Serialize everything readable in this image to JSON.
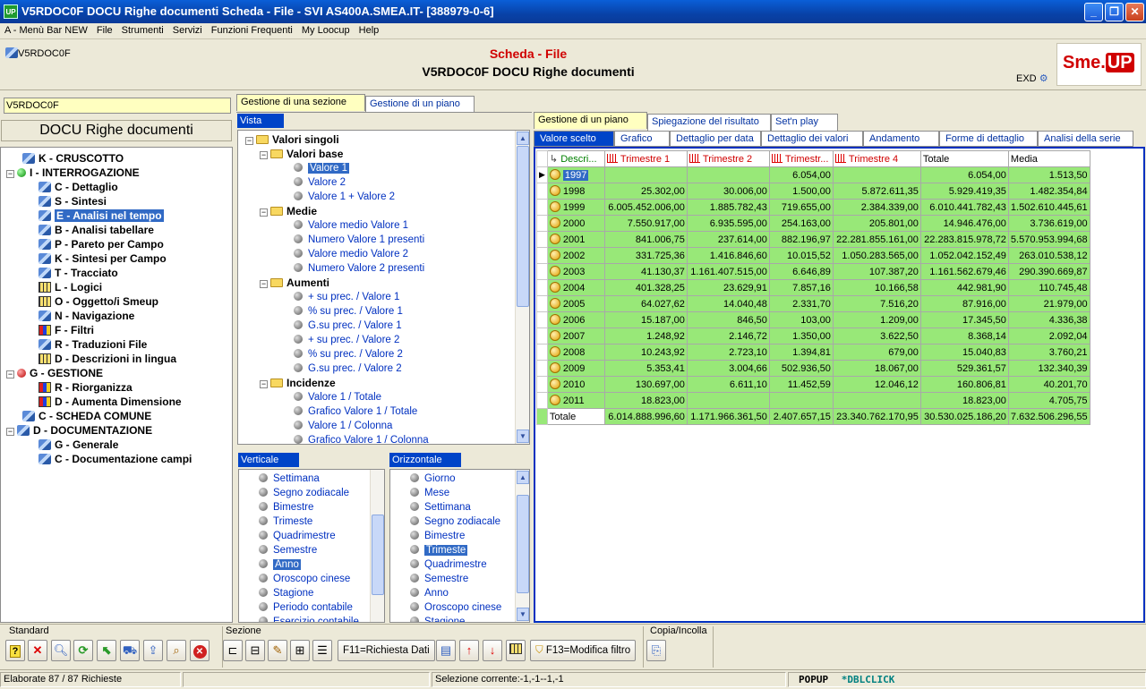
{
  "window": {
    "title": "V5RDOC0F DOCU Righe documenti Scheda - File - SVI AS400A.SMEA.IT- [388979-0-6]",
    "app_icon": "UP"
  },
  "menu": [
    "A - Menù Bar NEW",
    "File",
    "Strumenti",
    "Servizi",
    "Funzioni Frequenti",
    "My Loocup",
    "Help"
  ],
  "header": {
    "object_code": "V5RDOC0F",
    "title_red": "Scheda - File",
    "title_main": "V5RDOC0F DOCU Righe documenti",
    "exd_label": "EXD",
    "logo_text_1": "Sme.",
    "logo_text_2": "UP"
  },
  "left": {
    "input_value": "V5RDOC0F",
    "doc_title": "DOCU Righe documenti",
    "tree": [
      {
        "label": "K - CRUSCOTTO",
        "icon": "gear-icon",
        "level": 1
      },
      {
        "label": "I - INTERROGAZIONE",
        "icon": "green-dot-icon",
        "level": 0,
        "expander": "−"
      },
      {
        "label": "C - Dettaglio",
        "icon": "gear-icon",
        "level": 2
      },
      {
        "label": "S - Sintesi",
        "icon": "gear-icon",
        "level": 2
      },
      {
        "label": "E - Analisi nel tempo",
        "icon": "gear-icon",
        "level": 2,
        "selected": true
      },
      {
        "label": "B - Analisi tabellare",
        "icon": "gear-icon",
        "level": 2
      },
      {
        "label": "P - Pareto per Campo",
        "icon": "gear-icon",
        "level": 2
      },
      {
        "label": "K - Sintesi per Campo",
        "icon": "gear-icon",
        "level": 2
      },
      {
        "label": "T - Tracciato",
        "icon": "gear-icon",
        "level": 2
      },
      {
        "label": "L - Logici",
        "icon": "columns-icon",
        "level": 2
      },
      {
        "label": "O - Oggetto/i Smeup",
        "icon": "columns-icon",
        "level": 2
      },
      {
        "label": "N - Navigazione",
        "icon": "gear-icon",
        "level": 2
      },
      {
        "label": "F - Filtri",
        "icon": "color-grid-icon",
        "level": 2
      },
      {
        "label": "R - Traduzioni File",
        "icon": "gear-icon",
        "level": 2
      },
      {
        "label": "D - Descrizioni in lingua",
        "icon": "columns-icon",
        "level": 2
      },
      {
        "label": "G - GESTIONE",
        "icon": "red-dot-icon",
        "level": 0,
        "expander": "−"
      },
      {
        "label": "R - Riorganizza",
        "icon": "color-grid-icon",
        "level": 2
      },
      {
        "label": "D - Aumenta Dimensione",
        "icon": "color-grid-icon",
        "level": 2
      },
      {
        "label": "C - SCHEDA COMUNE",
        "icon": "gear-icon",
        "level": 1
      },
      {
        "label": "D - DOCUMENTAZIONE",
        "icon": "gear-icon",
        "level": 0,
        "expander": "−"
      },
      {
        "label": "G - Generale",
        "icon": "gear-icon",
        "level": 2
      },
      {
        "label": "C - Documentazione campi",
        "icon": "gear-icon",
        "level": 2
      }
    ]
  },
  "middle": {
    "tabs": [
      "Gestione di una sezione",
      "Gestione di un piano"
    ],
    "vista_label": "Vista",
    "tree": [
      {
        "label": "Valori singoli",
        "type": "head",
        "level": 0
      },
      {
        "label": "Valori base",
        "type": "head",
        "level": 1
      },
      {
        "label": "Valore 1",
        "type": "item",
        "selected": true
      },
      {
        "label": "Valore 2",
        "type": "item"
      },
      {
        "label": "Valore 1 + Valore 2",
        "type": "item"
      },
      {
        "label": "Medie",
        "type": "head",
        "level": 1
      },
      {
        "label": "Valore medio Valore 1",
        "type": "item"
      },
      {
        "label": "Numero Valore 1 presenti",
        "type": "item"
      },
      {
        "label": "Valore medio Valore 2",
        "type": "item"
      },
      {
        "label": "Numero Valore 2 presenti",
        "type": "item"
      },
      {
        "label": "Aumenti",
        "type": "head",
        "level": 1
      },
      {
        "label": "+ su prec. / Valore 1",
        "type": "item"
      },
      {
        "label": "% su prec. / Valore 1",
        "type": "item"
      },
      {
        "label": "G.su prec. / Valore 1",
        "type": "item"
      },
      {
        "label": "+ su prec. / Valore 2",
        "type": "item"
      },
      {
        "label": "% su prec. / Valore 2",
        "type": "item"
      },
      {
        "label": "G.su prec. / Valore 2",
        "type": "item"
      },
      {
        "label": "Incidenze",
        "type": "head",
        "level": 1
      },
      {
        "label": "Valore 1 / Totale",
        "type": "item"
      },
      {
        "label": "Grafico Valore 1 / Totale",
        "type": "item"
      },
      {
        "label": "Valore 1 / Colonna",
        "type": "item"
      },
      {
        "label": "Grafico Valore 1 / Colonna",
        "type": "item"
      }
    ],
    "verticale": {
      "label": "Verticale",
      "items": [
        "Settimana",
        "Segno zodiacale",
        "Bimestre",
        "Trimeste",
        "Quadrimestre",
        "Semestre",
        "Anno",
        "Oroscopo cinese",
        "Stagione",
        "Periodo contabile",
        "Esercizio contabile"
      ],
      "selected": "Anno"
    },
    "orizzontale": {
      "label": "Orizzontale",
      "items": [
        "Giorno",
        "Mese",
        "Settimana",
        "Segno zodiacale",
        "Bimestre",
        "Trimeste",
        "Quadrimestre",
        "Semestre",
        "Anno",
        "Oroscopo cinese",
        "Stagione"
      ],
      "selected": "Trimeste"
    }
  },
  "right": {
    "tabs": [
      "Gestione di un piano",
      "Spiegazione del risultato",
      "Set'n play"
    ],
    "subtabs": [
      "Valore scelto",
      "Grafico",
      "Dettaglio per data",
      "Dettaglio dei valori",
      "Andamento",
      "Forme di dettaglio",
      "Analisi della serie"
    ],
    "grid": {
      "headers": [
        "Descri...",
        "Trimestre 1",
        "Trimestre 2",
        "Trimestr...",
        "Trimestre 4",
        "Totale",
        "Media"
      ],
      "rows": [
        {
          "year": "1997",
          "t1": "",
          "t2": "",
          "t3": "6.054,00",
          "t4": "",
          "tot": "6.054,00",
          "avg": "1.513,50",
          "current": true
        },
        {
          "year": "1998",
          "t1": "25.302,00",
          "t2": "30.006,00",
          "t3": "1.500,00",
          "t4": "5.872.611,35",
          "tot": "5.929.419,35",
          "avg": "1.482.354,84"
        },
        {
          "year": "1999",
          "t1": "6.005.452.006,00",
          "t2": "1.885.782,43",
          "t3": "719.655,00",
          "t4": "2.384.339,00",
          "tot": "6.010.441.782,43",
          "avg": "1.502.610.445,61"
        },
        {
          "year": "2000",
          "t1": "7.550.917,00",
          "t2": "6.935.595,00",
          "t3": "254.163,00",
          "t4": "205.801,00",
          "tot": "14.946.476,00",
          "avg": "3.736.619,00"
        },
        {
          "year": "2001",
          "t1": "841.006,75",
          "t2": "237.614,00",
          "t3": "882.196,97",
          "t4": "22.281.855.161,00",
          "tot": "22.283.815.978,72",
          "avg": "5.570.953.994,68"
        },
        {
          "year": "2002",
          "t1": "331.725,36",
          "t2": "1.416.846,60",
          "t3": "10.015,52",
          "t4": "1.050.283.565,00",
          "tot": "1.052.042.152,49",
          "avg": "263.010.538,12"
        },
        {
          "year": "2003",
          "t1": "41.130,37",
          "t2": "1.161.407.515,00",
          "t3": "6.646,89",
          "t4": "107.387,20",
          "tot": "1.161.562.679,46",
          "avg": "290.390.669,87"
        },
        {
          "year": "2004",
          "t1": "401.328,25",
          "t2": "23.629,91",
          "t3": "7.857,16",
          "t4": "10.166,58",
          "tot": "442.981,90",
          "avg": "110.745,48"
        },
        {
          "year": "2005",
          "t1": "64.027,62",
          "t2": "14.040,48",
          "t3": "2.331,70",
          "t4": "7.516,20",
          "tot": "87.916,00",
          "avg": "21.979,00"
        },
        {
          "year": "2006",
          "t1": "15.187,00",
          "t2": "846,50",
          "t3": "103,00",
          "t4": "1.209,00",
          "tot": "17.345,50",
          "avg": "4.336,38"
        },
        {
          "year": "2007",
          "t1": "1.248,92",
          "t2": "2.146,72",
          "t3": "1.350,00",
          "t4": "3.622,50",
          "tot": "8.368,14",
          "avg": "2.092,04"
        },
        {
          "year": "2008",
          "t1": "10.243,92",
          "t2": "2.723,10",
          "t3": "1.394,81",
          "t4": "679,00",
          "tot": "15.040,83",
          "avg": "3.760,21"
        },
        {
          "year": "2009",
          "t1": "5.353,41",
          "t2": "3.004,66",
          "t3": "502.936,50",
          "t4": "18.067,00",
          "tot": "529.361,57",
          "avg": "132.340,39"
        },
        {
          "year": "2010",
          "t1": "130.697,00",
          "t2": "6.611,10",
          "t3": "11.452,59",
          "t4": "12.046,12",
          "tot": "160.806,81",
          "avg": "40.201,70"
        },
        {
          "year": "2011",
          "t1": "18.823,00",
          "t2": "",
          "t3": "",
          "t4": "",
          "tot": "18.823,00",
          "avg": "4.705,75"
        }
      ],
      "total_row": {
        "label": "Totale",
        "t1": "6.014.888.996,60",
        "t2": "1.171.966.361,50",
        "t3": "2.407.657,15",
        "t4": "23.340.762.170,95",
        "tot": "30.530.025.186,20",
        "avg": "7.632.506.296,55"
      }
    }
  },
  "toolbar": {
    "group_standard": "Standard",
    "group_sezione": "Sezione",
    "group_copia": "Copia/Incolla",
    "f11_label": "F11=Richiesta Dati",
    "f13_label": "F13=Modifica filtro"
  },
  "status": {
    "left": "Elaborate 87 / 87 Richieste",
    "selection": "Selezione corrente:-1,-1--1,-1",
    "popup": "POPUP",
    "dblclick": "*DBLCLICK"
  }
}
